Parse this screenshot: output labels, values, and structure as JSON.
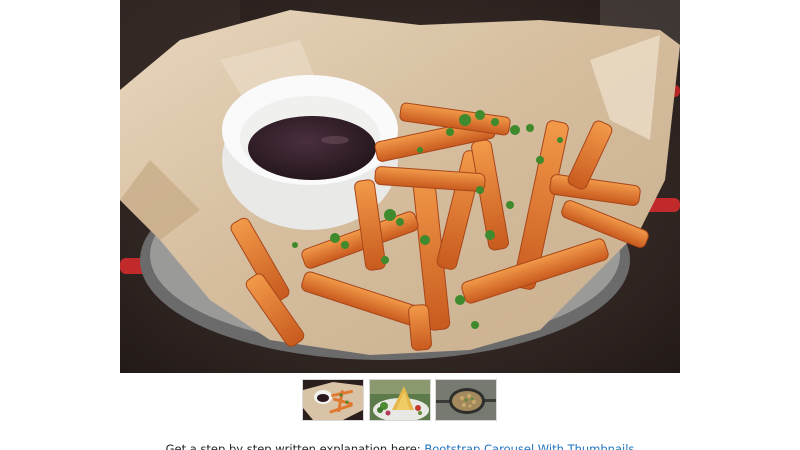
{
  "carousel": {
    "main_image_icon": "sweet-potato-fries-photo",
    "thumbnails": [
      {
        "icon": "fries-thumbnail-photo"
      },
      {
        "icon": "salad-dish-thumbnail-photo"
      },
      {
        "icon": "pan-dish-thumbnail-photo"
      }
    ]
  },
  "caption": {
    "prefix": "Get a step by step written explanation here: ",
    "link_text": "Bootstrap Carousel With Thumbnails"
  },
  "colors": {
    "link": "#1e73be",
    "text": "#212529",
    "fries": "#e0782f",
    "table": "#2a1f1c",
    "paper": "#d9c3a6"
  }
}
